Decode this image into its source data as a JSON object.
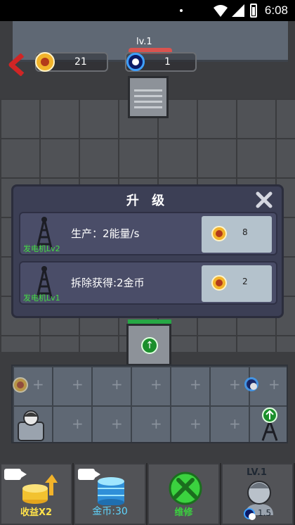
{
  "status": {
    "time": "6:08"
  },
  "hud": {
    "coins": "21",
    "energy": "1",
    "room_level": "lv.1"
  },
  "modal": {
    "title": "升 级",
    "rows": [
      {
        "tower_label": "发电机Lv2",
        "description": "生产：2能量/s",
        "cost": "8"
      },
      {
        "tower_label": "发电机Lv1",
        "description": "拆除获得:2金币",
        "cost": "2"
      }
    ]
  },
  "bottom": {
    "income": "收益X2",
    "gold": "金币:30",
    "repair": "维修",
    "level": "LV.1",
    "level_sub": "1.5"
  },
  "colors": {
    "accent_green": "#26a845",
    "coin_gold": "#f2b32a",
    "energy_blue": "#3ea0ff",
    "danger_red": "#d9534f"
  }
}
